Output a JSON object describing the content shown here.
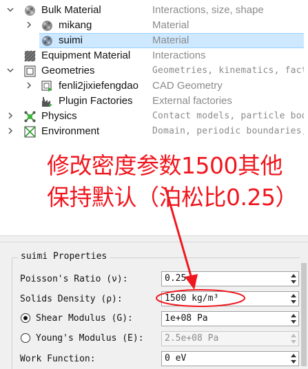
{
  "tree": {
    "rows": [
      {
        "label": "Bulk Material",
        "desc": "Interactions, size, shape"
      },
      {
        "label": "mikang",
        "desc": "Material"
      },
      {
        "label": "suimi",
        "desc": "Material"
      },
      {
        "label": "Equipment Material",
        "desc": "Interactions"
      },
      {
        "label": "Geometries",
        "desc": "Geometries, kinematics, facto"
      },
      {
        "label": "fenli2jixiefengdao",
        "desc": "CAD Geometry"
      },
      {
        "label": "Plugin Factories",
        "desc": "External factories"
      },
      {
        "label": "Physics",
        "desc": "Contact models, particle body"
      },
      {
        "label": "Environment",
        "desc": "Domain, periodic boundaries,"
      }
    ],
    "selected_index": 2
  },
  "properties": {
    "title": "suimi Properties",
    "poisson_label": "Poisson's Ratio (ν):",
    "poisson_value": "0.25",
    "density_label": "Solids Density (ρ):",
    "density_value": "1500 kg/m³",
    "shear_label": "Shear Modulus (G):",
    "shear_value": "1e+08 Pa",
    "young_label": "Young's Modulus (E):",
    "young_value": "2.5e+08 Pa",
    "work_label": "Work Function:",
    "work_value": "0 eV",
    "selected_modulus": "shear"
  },
  "annotation": {
    "text": "修改密度参数1500其他保持默认（泊松比0.25）",
    "color": "#f0161e"
  },
  "colors": {
    "selection": "#cde8ff",
    "panel": "#f0f0f0",
    "annotation_red": "#f0161e"
  },
  "icons": {
    "bulk_material": "bulk-material-icon",
    "material": "material-sphere-icon",
    "equipment": "equipment-material-icon",
    "geometries": "geometries-icon",
    "cad": "cad-geometry-icon",
    "plugin": "plugin-factory-icon",
    "physics": "physics-icon",
    "environment": "environment-icon"
  }
}
